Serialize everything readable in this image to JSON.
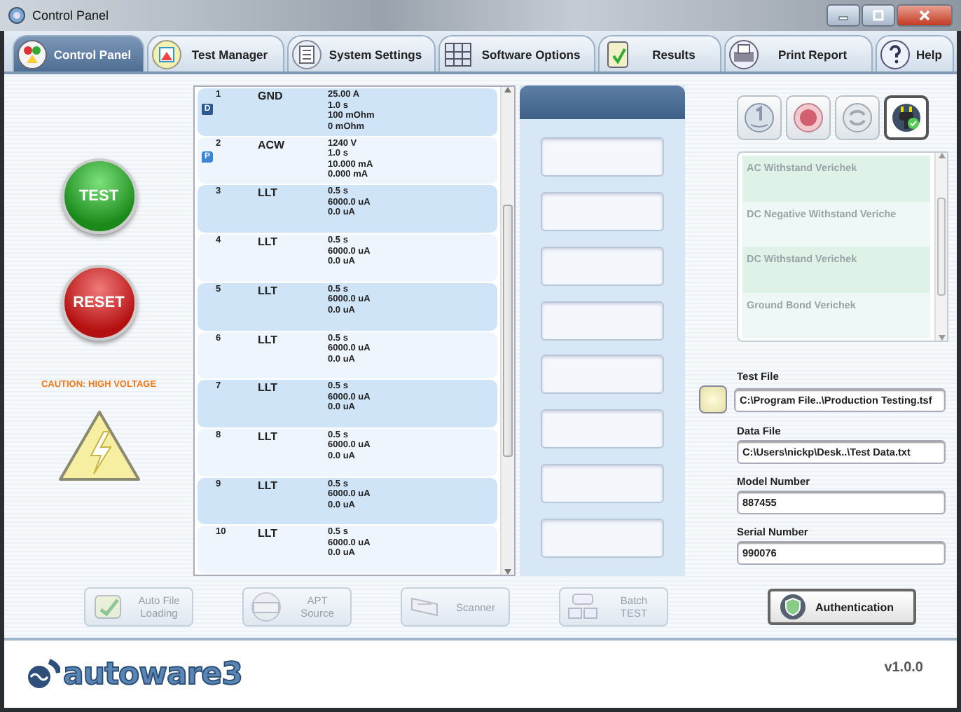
{
  "window": {
    "title": "Control Panel"
  },
  "tabs": [
    {
      "label": "Control Panel",
      "selected": true
    },
    {
      "label": "Test Manager",
      "selected": false
    },
    {
      "label": "System Settings",
      "selected": false
    },
    {
      "label": "Software Options",
      "selected": false
    },
    {
      "label": "Results",
      "selected": false
    },
    {
      "label": "Print Report",
      "selected": false
    },
    {
      "label": "Help",
      "selected": false
    }
  ],
  "controls": {
    "test": "TEST",
    "reset": "RESET",
    "caution": "CAUTION: HIGH VOLTAGE"
  },
  "steps": [
    {
      "number": "1",
      "badge": "D",
      "type": "GND",
      "params": [
        "25.00 A",
        "1.0 s",
        "100 mOhm",
        "0 mOhm"
      ]
    },
    {
      "number": "2",
      "badge": "P",
      "type": "ACW",
      "params": [
        "1240 V",
        "1.0 s",
        "10.000 mA",
        "0.000 mA"
      ]
    },
    {
      "number": "3",
      "type": "LLT",
      "params": [
        "0.5 s",
        "6000.0 uA",
        "0.0 uA"
      ]
    },
    {
      "number": "4",
      "type": "LLT",
      "params": [
        "0.5 s",
        "6000.0 uA",
        "0.0 uA"
      ]
    },
    {
      "number": "5",
      "type": "LLT",
      "params": [
        "0.5 s",
        "6000.0 uA",
        "0.0 uA"
      ]
    },
    {
      "number": "6",
      "type": "LLT",
      "params": [
        "0.5 s",
        "6000.0 uA",
        "0.0 uA"
      ]
    },
    {
      "number": "7",
      "type": "LLT",
      "params": [
        "0.5 s",
        "6000.0 uA",
        "0.0 uA"
      ]
    },
    {
      "number": "8",
      "type": "LLT",
      "params": [
        "0.5 s",
        "6000.0 uA",
        "0.0 uA"
      ]
    },
    {
      "number": "9",
      "type": "LLT",
      "params": [
        "0.5 s",
        "6000.0 uA",
        "0.0 uA"
      ]
    },
    {
      "number": "10",
      "type": "LLT",
      "params": [
        "0.5 s",
        "6000.0 uA",
        "0.0 uA"
      ]
    }
  ],
  "modes": [
    {
      "selected": false
    },
    {
      "selected": false
    },
    {
      "selected": false
    },
    {
      "selected": true
    }
  ],
  "verichek": [
    {
      "label": "AC Withstand Verichek"
    },
    {
      "label": "DC Negative Withstand Veriche"
    },
    {
      "label": "DC Withstand Verichek"
    },
    {
      "label": "Ground Bond Verichek"
    }
  ],
  "fields": [
    {
      "label": "Test File",
      "value": "C:\\Program File..\\Production Testing.tsf",
      "browse": true
    },
    {
      "label": "Data File",
      "value": "C:\\Users\\nickp\\Desk..\\Test Data.txt",
      "browse": false
    },
    {
      "label": "Model Number",
      "value": "887455",
      "browse": false
    },
    {
      "label": "Serial Number",
      "value": "990076",
      "browse": false
    }
  ],
  "actions": [
    {
      "label": "Auto File Loading",
      "disabled": true
    },
    {
      "label": "APT Source",
      "disabled": true
    },
    {
      "label": "Scanner",
      "disabled": true
    },
    {
      "label": "Batch TEST",
      "disabled": true
    }
  ],
  "auth_button": "Authentication",
  "footer": {
    "logo": "autoware3",
    "version": "v1.0.0"
  }
}
